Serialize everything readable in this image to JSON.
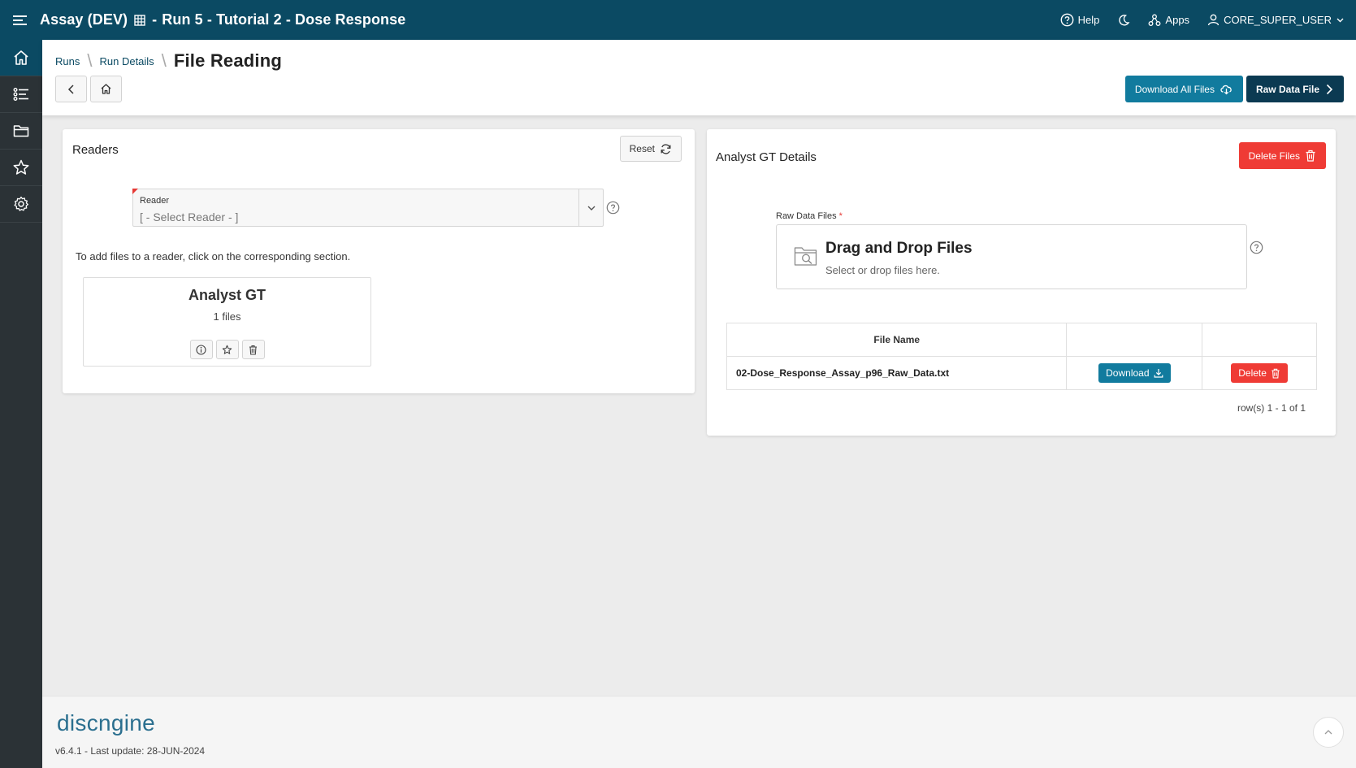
{
  "header": {
    "app_name": "Assay (DEV)",
    "run_title": "Run 5 - Tutorial 2 - Dose Response",
    "help_label": "Help",
    "apps_label": "Apps",
    "user_label": "CORE_SUPER_USER"
  },
  "sidebar": {
    "items": [
      {
        "icon": "home-icon",
        "active": true
      },
      {
        "icon": "list-icon"
      },
      {
        "icon": "folder-icon"
      },
      {
        "icon": "star-icon"
      },
      {
        "icon": "gear-icon"
      }
    ]
  },
  "breadcrumb": {
    "items": [
      "Runs",
      "Run Details"
    ],
    "current": "File Reading"
  },
  "actions": {
    "download_all_label": "Download All Files",
    "raw_data_file_label": "Raw Data File"
  },
  "readers": {
    "title": "Readers",
    "reset_label": "Reset",
    "select_label": "Reader",
    "select_placeholder": "[ - Select Reader - ]",
    "hint": "To add files to a reader, click on the corresponding section.",
    "tile": {
      "name": "Analyst GT",
      "count": "1 files"
    }
  },
  "details": {
    "title": "Analyst GT Details",
    "delete_files_label": "Delete Files",
    "dropzone_label": "Raw Data Files",
    "dropzone_required": "*",
    "dropzone_title": "Drag and Drop Files",
    "dropzone_sub": "Select or drop files here.",
    "table": {
      "columns": [
        "File Name",
        "",
        ""
      ],
      "rows": [
        {
          "name": "02-Dose_Response_Assay_p96_Raw_Data.txt",
          "download_label": "Download",
          "delete_label": "Delete"
        }
      ]
    },
    "pager": "row(s) 1 - 1 of 1"
  },
  "footer": {
    "logo": "discngine",
    "version": "v6.4.1 - Last update: 28-JUN-2024"
  },
  "colors": {
    "header": "#0b4a63",
    "sidebar": "#2b3236",
    "teal_button": "#117b9e",
    "navy_button": "#0b3a52",
    "danger": "#ef3b35"
  }
}
